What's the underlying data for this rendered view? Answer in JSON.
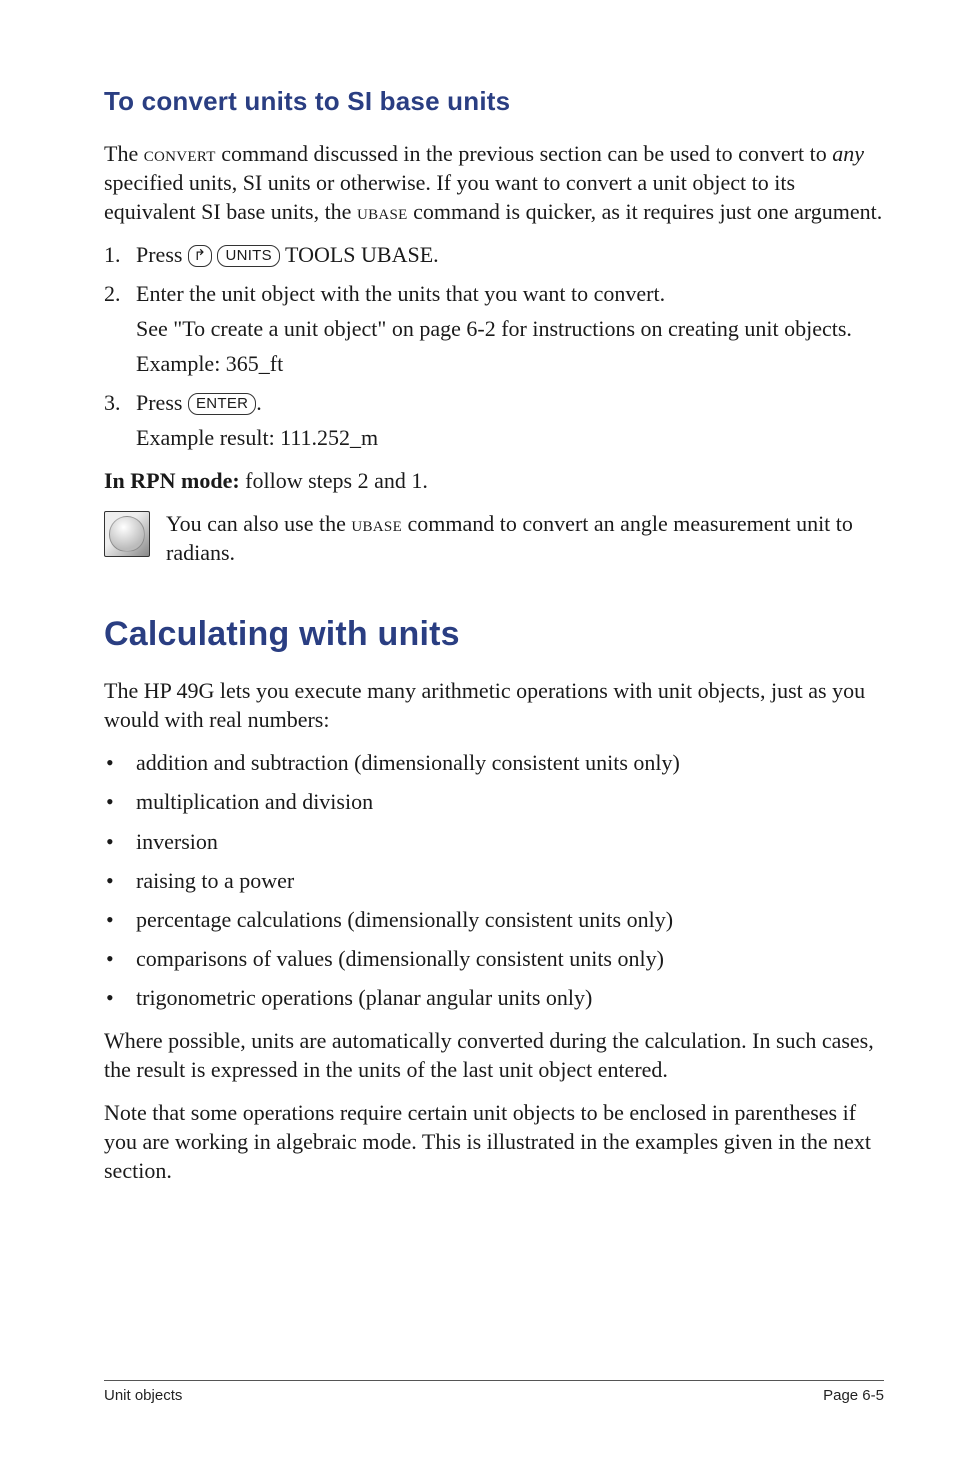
{
  "section1": {
    "title": "To convert units to SI base units",
    "intro_pre": "The ",
    "intro_cmd1": "convert",
    "intro_mid1": " command discussed in the previous section can be used to convert to ",
    "intro_any": "any",
    "intro_mid2": " specified units, SI units or otherwise. If you want to convert a unit object to its equivalent SI base units, the ",
    "intro_cmd2": "ubase",
    "intro_post": " command is quicker, as it requires just one argument.",
    "step1_pre": "Press ",
    "step1_key1": "↱",
    "step1_key2": "UNITS",
    "step1_post": " TOOLS UBASE.",
    "step2_line1": "Enter the unit object with the units that you want to convert.",
    "step2_line2": "See \"To create a unit object\" on page 6-2 for instructions on creating unit objects.",
    "step2_line3": "Example: 365_ft",
    "step3_pre": "Press ",
    "step3_key": "ENTER",
    "step3_post": ".",
    "step3_result": "Example result: 111.252_m",
    "rpn_bold": "In RPN mode:",
    "rpn_rest": " follow steps 2 and 1.",
    "tip_pre": "You can also use the ",
    "tip_cmd": "ubase",
    "tip_post": " command to convert an angle measurement unit to radians."
  },
  "section2": {
    "title": "Calculating with units",
    "intro": "The HP 49G lets you execute many arithmetic operations with unit objects, just as you would with real numbers:",
    "bullets": [
      "addition and subtraction (dimensionally consistent units only)",
      "multiplication and division",
      "inversion",
      "raising to a power",
      "percentage calculations (dimensionally consistent units only)",
      "comparisons of values (dimensionally consistent units only)",
      "trigonometric operations (planar angular units only)"
    ],
    "para2": "Where possible, units are automatically converted during the calculation. In such cases, the result is expressed in the units of the last unit object entered.",
    "para3": "Note that some operations require certain unit objects to be enclosed in parentheses if you are working in algebraic mode. This is illustrated in the examples given in the next section."
  },
  "footer": {
    "left": "Unit objects",
    "right": "Page 6-5"
  }
}
